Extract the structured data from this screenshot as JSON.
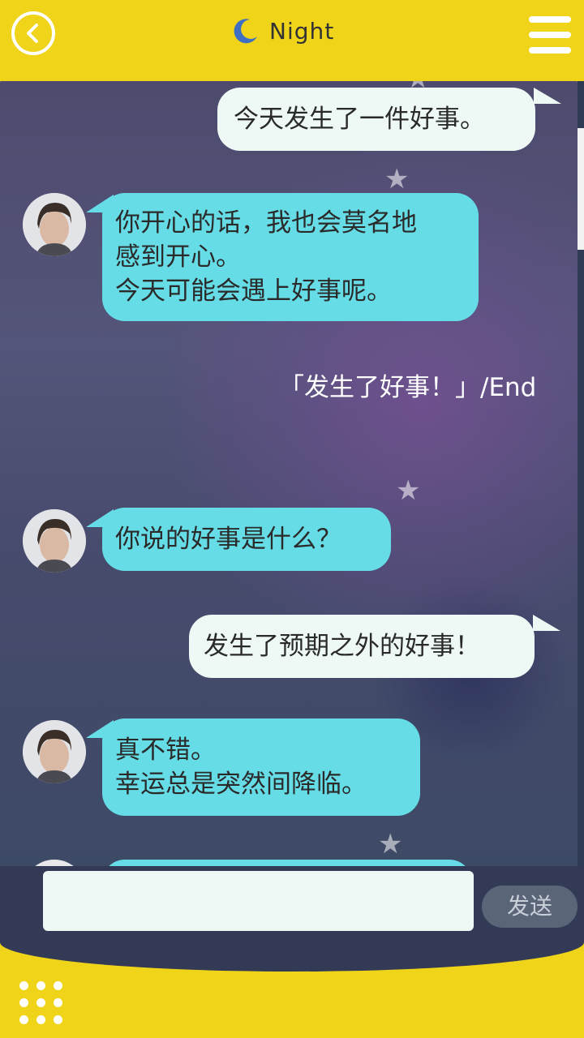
{
  "header": {
    "title": "Night",
    "back_icon": "back-arrow-icon",
    "moon_icon": "moon-icon",
    "menu_icon": "hamburger-menu-icon"
  },
  "messages": [
    {
      "from": "user",
      "lines": [
        "今天发生了一件好事。"
      ]
    },
    {
      "from": "bot",
      "lines": [
        "你开心的话，我也会莫名地",
        "感到开心。",
        "今天可能会遇上好事呢。"
      ]
    },
    {
      "system": "「发生了好事！」/End"
    },
    {
      "from": "bot",
      "lines": [
        "你说的好事是什么？"
      ]
    },
    {
      "from": "user",
      "lines": [
        "发生了预期之外的好事！"
      ]
    },
    {
      "from": "bot",
      "lines": [
        "真不错。",
        "幸运总是突然间降临。"
      ]
    }
  ],
  "input": {
    "value": "",
    "placeholder": ""
  },
  "send_label": "发送",
  "footer": {
    "grid_icon": "grid-menu-icon"
  },
  "colors": {
    "accent": "#f0d41a",
    "bot_bubble": "#66dde6",
    "user_bubble": "#eef9f5",
    "send_button": "#5a6678"
  }
}
